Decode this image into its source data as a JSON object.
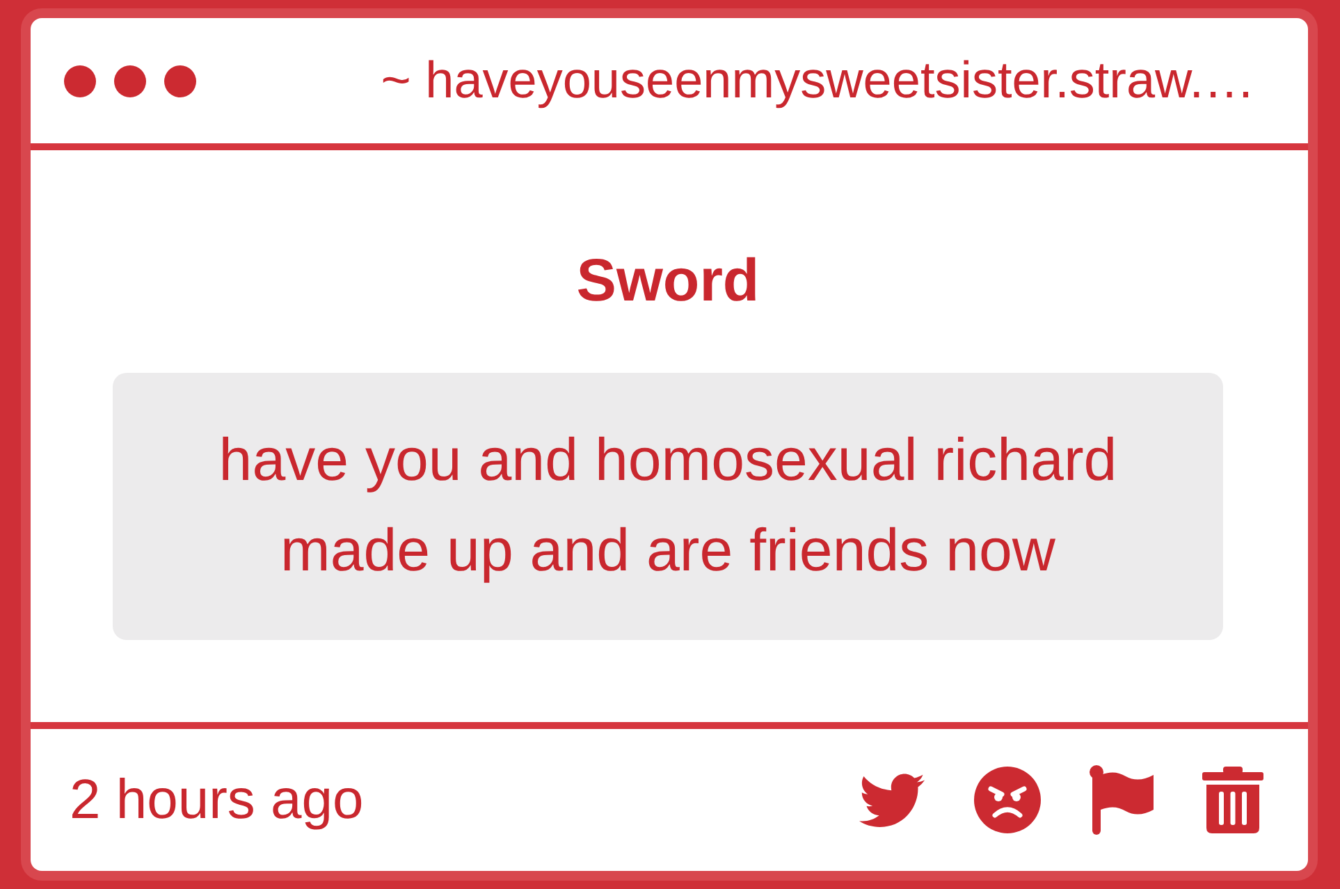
{
  "window": {
    "url": "~ haveyouseenmysweetsister.straw.…"
  },
  "message": {
    "title": "Sword",
    "text": "have you and homosexual richard made up and are friends now"
  },
  "footer": {
    "time": "2 hours ago"
  }
}
